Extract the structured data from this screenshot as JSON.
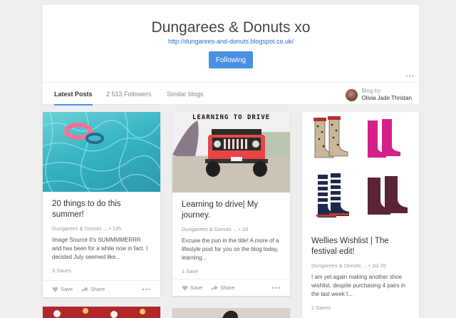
{
  "header": {
    "title": "Dungarees & Donuts xo",
    "url": "http://dungarees-and-donuts.blogspot.co.uk/",
    "follow_label": "Following",
    "more": "•••"
  },
  "tabs": [
    {
      "label": "Latest Posts",
      "active": true
    },
    {
      "label": "2 513 Followers",
      "active": false
    },
    {
      "label": "Similar blogs",
      "active": false
    }
  ],
  "blog_by": {
    "label": "Blog by",
    "name": "Olivia Jade Thristan"
  },
  "posts": [
    {
      "title": "20 things to do this summer!",
      "meta": "Dungarees & Donuts ... • 12h",
      "excerpt": "Image Source It's SUMMMMERRR and has been for a while now in fact. I decided July seemed like...",
      "saves": "3 Saves",
      "save_label": "Save",
      "share_label": "Share",
      "more": "•••"
    },
    {
      "title": "Learning to drive| My journey.",
      "image_caption": "LEARNING TO DRIVE",
      "meta": "Dungarees & Donuts ... • 2d",
      "excerpt": "Excuse the pun in the title! A more of a lifestyle post for you on the blog today, learning...",
      "saves": "1 Save",
      "save_label": "Save",
      "share_label": "Share",
      "more": "•••"
    },
    {
      "title": "Wellies Wishlist | The festival edit!",
      "meta": "Dungarees & Donuts ... • Jul 20",
      "excerpt": "I am yet again making another shoe wishlist, despite purchasing 4 pairs in the last week I...",
      "saves": "2 Saves"
    }
  ],
  "colors": {
    "accent": "#4a90e2",
    "link": "#2a6cc6",
    "background": "#eeeeee"
  }
}
